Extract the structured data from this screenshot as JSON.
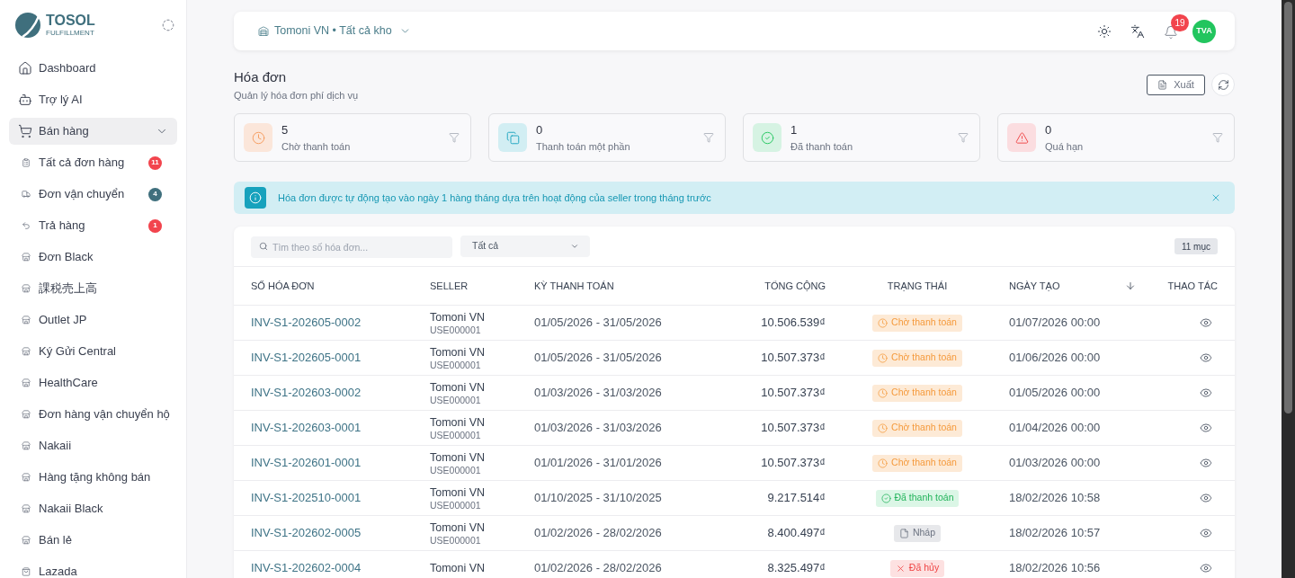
{
  "sidebar": {
    "logo": {
      "name": "TOSOL",
      "tagline": "FULFILLMENT"
    },
    "items": [
      {
        "label": "Dashboard",
        "selected": false,
        "expanded": false
      },
      {
        "label": "Trợ lý AI",
        "selected": false,
        "expanded": false
      },
      {
        "label": "Bán hàng",
        "selected": true,
        "expanded": true,
        "children": [
          {
            "label": "Tất cả đơn hàng",
            "selected": false,
            "badge": "11",
            "color": "#f2444d"
          },
          {
            "label": "Đơn vận chuyển",
            "selected": false,
            "badge": "4",
            "color": "#3f6f7d"
          },
          {
            "label": "Trả hàng",
            "selected": false,
            "badge": "1",
            "color": "#f2444d"
          },
          {
            "label": "Đơn Black",
            "selected": false
          },
          {
            "label": "課税売上高",
            "selected": false
          },
          {
            "label": "Outlet JP",
            "selected": false
          },
          {
            "label": "Ký Gửi Central",
            "selected": false
          },
          {
            "label": "HealthCare",
            "selected": false
          },
          {
            "label": "Đơn hàng vận chuyển hộ",
            "selected": false
          },
          {
            "label": "Nakaii",
            "selected": false
          },
          {
            "label": "Hàng tặng không bán",
            "selected": false
          },
          {
            "label": "Nakaii Black",
            "selected": false
          },
          {
            "label": "Bán lẻ",
            "selected": false
          },
          {
            "label": "Lazada",
            "selected": false
          }
        ]
      }
    ]
  },
  "topbar": {
    "workspace": "Tomoni VN • Tất cả kho",
    "notifications": "19",
    "avatar": "TVA"
  },
  "header": {
    "title": "Hóa đơn",
    "subtitle": "Quản lý hóa đơn phí dịch vụ",
    "export_button": "Xuất"
  },
  "stats": [
    {
      "kind": "pending",
      "value": "5",
      "label": "Chờ thanh toán"
    },
    {
      "kind": "partial",
      "value": "0",
      "label": "Thanh toán một phần"
    },
    {
      "kind": "paid",
      "value": "1",
      "label": "Đã thanh toán"
    },
    {
      "kind": "overdue",
      "value": "0",
      "label": "Quá hạn"
    }
  ],
  "alert": {
    "text": "Hóa đơn được tự động tạo vào ngày 1 hàng tháng dựa trên hoạt động của seller trong tháng trước"
  },
  "table": {
    "search": {
      "placeholder": "Tìm theo số hóa đơn..."
    },
    "filter": {
      "value": "Tất cả"
    },
    "count": "11 mục",
    "columns": [
      "SỐ HÓA ĐƠN",
      "SELLER",
      "KỲ THANH TOÁN",
      "TỔNG CỘNG",
      "TRẠNG THÁI",
      "NGÀY TẠO",
      "THAO TÁC"
    ],
    "rows": [
      {
        "invoice": "INV-S1-202605-0002",
        "seller": "Tomoni VN",
        "seller_code": "USE000001",
        "period": "01/05/2026 - 31/05/2026",
        "total": "10.506.539₫",
        "status": {
          "kind": "pending",
          "label": "Chờ thanh toán"
        },
        "created": "01/07/2026 00:00"
      },
      {
        "invoice": "INV-S1-202605-0001",
        "seller": "Tomoni VN",
        "seller_code": "USE000001",
        "period": "01/05/2026 - 31/05/2026",
        "total": "10.507.373₫",
        "status": {
          "kind": "pending",
          "label": "Chờ thanh toán"
        },
        "created": "01/06/2026 00:00"
      },
      {
        "invoice": "INV-S1-202603-0002",
        "seller": "Tomoni VN",
        "seller_code": "USE000001",
        "period": "01/03/2026 - 31/03/2026",
        "total": "10.507.373₫",
        "status": {
          "kind": "pending",
          "label": "Chờ thanh toán"
        },
        "created": "01/05/2026 00:00"
      },
      {
        "invoice": "INV-S1-202603-0001",
        "seller": "Tomoni VN",
        "seller_code": "USE000001",
        "period": "01/03/2026 - 31/03/2026",
        "total": "10.507.373₫",
        "status": {
          "kind": "pending",
          "label": "Chờ thanh toán"
        },
        "created": "01/04/2026 00:00"
      },
      {
        "invoice": "INV-S1-202601-0001",
        "seller": "Tomoni VN",
        "seller_code": "USE000001",
        "period": "01/01/2026 - 31/01/2026",
        "total": "10.507.373₫",
        "status": {
          "kind": "pending",
          "label": "Chờ thanh toán"
        },
        "created": "01/03/2026 00:00"
      },
      {
        "invoice": "INV-S1-202510-0001",
        "seller": "Tomoni VN",
        "seller_code": "USE000001",
        "period": "01/10/2025 - 31/10/2025",
        "total": "9.217.514₫",
        "status": {
          "kind": "paid",
          "label": "Đã thanh toán"
        },
        "created": "18/02/2026 10:58"
      },
      {
        "invoice": "INV-S1-202602-0005",
        "seller": "Tomoni VN",
        "seller_code": "USE000001",
        "period": "01/02/2026 - 28/02/2026",
        "total": "8.400.497₫",
        "status": {
          "kind": "draft",
          "label": "Nháp"
        },
        "created": "18/02/2026 10:57"
      },
      {
        "invoice": "INV-S1-202602-0004",
        "seller": "Tomoni VN",
        "period": "01/02/2026 - 28/02/2026",
        "total": "8.325.497₫",
        "status": {
          "kind": "cancelled",
          "label": "Đã hủy"
        },
        "created": "18/02/2026 10:56"
      }
    ]
  }
}
